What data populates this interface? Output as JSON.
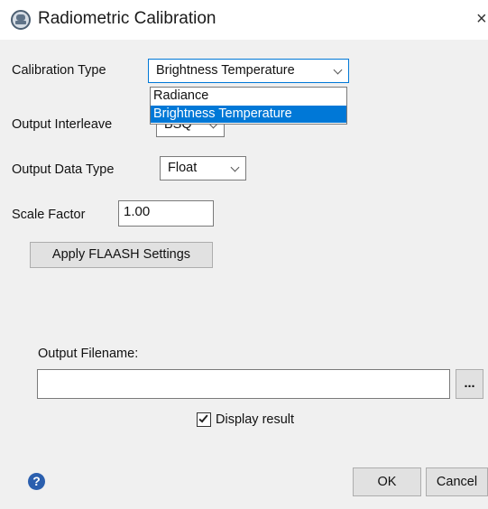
{
  "window": {
    "title": "Radiometric Calibration",
    "close_glyph": "×"
  },
  "calibration_type": {
    "label": "Calibration Type",
    "selected": "Brightness Temperature",
    "options": [
      "Radiance",
      "Brightness Temperature"
    ],
    "expanded": true
  },
  "output_interleave": {
    "label": "Output Interleave",
    "selected": "BSQ"
  },
  "output_data_type": {
    "label": "Output Data Type",
    "selected": "Float"
  },
  "scale_factor": {
    "label": "Scale Factor",
    "value": "1.00"
  },
  "flaash_button": {
    "label": "Apply FLAASH Settings"
  },
  "output_filename": {
    "label": "Output Filename:",
    "value": "",
    "browse_label": "..."
  },
  "display_result": {
    "label": "Display result",
    "checked": true
  },
  "footer": {
    "help_glyph": "?",
    "ok_label": "OK",
    "cancel_label": "Cancel"
  },
  "colors": {
    "selection": "#0078d7",
    "help_icon": "#2b5fae",
    "background": "#f0f0f0"
  }
}
